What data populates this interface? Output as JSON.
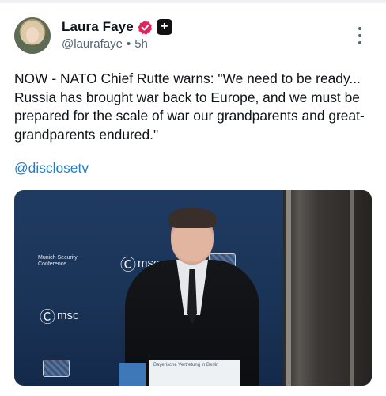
{
  "post": {
    "author": {
      "display_name": "Laura Faye",
      "handle": "@laurafaye",
      "avatar_icon": "avatar-photo",
      "verified_icon": "verified-badge-icon",
      "verified_color": "#e0245e",
      "plus_label": "+"
    },
    "time_separator": "•",
    "age": "5h",
    "more_icon": "more-vertical-icon",
    "text": "NOW - NATO Chief Rutte warns: \"We need to be ready... Russia has brought war back to Europe, and we must be prepared for the scale of war our grandparents and great-grandparents endured.\"",
    "mention": "@disclosetv",
    "mention_color": "#1d7fc9"
  },
  "media": {
    "description_tags": [
      "video-still"
    ],
    "conference_name": "Munich Security\nConference",
    "msc_logo_a": "msc",
    "msc_logo_b": "msc",
    "lectern_caption": "Bayerische Vertretung in Berlin"
  }
}
